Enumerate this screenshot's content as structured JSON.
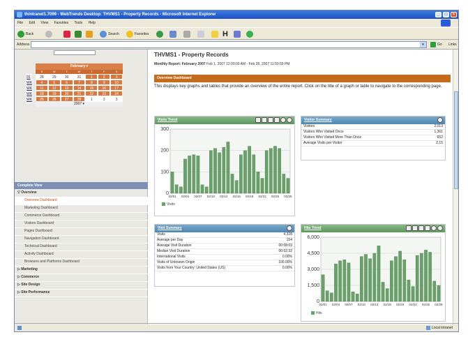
{
  "window": {
    "title": "thintranet1.7099 - WebTrends Desktop: THVMS1 - Property Records - Microsoft Internet Explorer"
  },
  "menu": [
    "File",
    "Edit",
    "View",
    "Favorites",
    "Tools",
    "Help"
  ],
  "toolbar": {
    "back": "Back",
    "search": "Search",
    "favorites": "Favorites"
  },
  "address": {
    "label": "Address",
    "go": "Go",
    "links": "Links"
  },
  "status": {
    "zone": "Local intranet"
  },
  "calendar": {
    "month": "February",
    "days": [
      "S",
      "M",
      "T",
      "W",
      "T",
      "F",
      "S"
    ],
    "weeks": [
      {
        "wk": "01",
        "cells": [
          "28",
          "29",
          "30",
          "31",
          "1",
          "2",
          "3"
        ]
      },
      {
        "wk": "WK",
        "cells": [
          "4",
          "5",
          "6",
          "7",
          "8",
          "9",
          "10"
        ]
      },
      {
        "wk": "WK",
        "cells": [
          "11",
          "12",
          "13",
          "14",
          "15",
          "16",
          "17"
        ]
      },
      {
        "wk": "WK",
        "cells": [
          "18",
          "19",
          "20",
          "21",
          "22",
          "23",
          "24"
        ]
      },
      {
        "wk": "WK",
        "cells": [
          "25",
          "26",
          "27",
          "28",
          "1",
          "2",
          "3"
        ]
      }
    ],
    "year": "2007"
  },
  "sidebar": {
    "complete_view": "Complete View",
    "overview": "Overview",
    "items": [
      "Overview Dashboard",
      "Marketing Dashboard",
      "Commerce Dashboard",
      "Visitors Dashboard",
      "Pages Dashboard",
      "Navigation Dashboard",
      "Technical Dashboard",
      "Activity Dashboard",
      "Browsers and Platforms Dashboard"
    ],
    "sections": [
      "Marketing",
      "Commerce",
      "Site Design",
      "Site Performance"
    ]
  },
  "page": {
    "title": "THVMS1 - Property Records",
    "report_label": "Monthly Report: February 2007",
    "report_range": "Feb 1, 2007 12:00:00 AM - Feb 28, 2007 11:59:59 PM",
    "overview_title": "Overview Dashboard",
    "overview_desc": "This displays key graphs and tables that provide an overview of the entire report. Click on the title of a graph or table to navigate to the corresponding page."
  },
  "visits_trend": {
    "title": "Visits Trend",
    "legend": "Visits",
    "yticks": [
      "300",
      "200",
      "100",
      "0"
    ],
    "xticks": [
      "02/01",
      "02/04",
      "02/07",
      "02/10",
      "02/13",
      "02/16",
      "02/19",
      "02/22",
      "02/25",
      "02/28"
    ],
    "chart_data": {
      "type": "area",
      "title": "Visits Trend",
      "ylim": [
        0,
        300
      ],
      "x": [
        "02/01",
        "02/02",
        "02/03",
        "02/04",
        "02/05",
        "02/06",
        "02/07",
        "02/08",
        "02/09",
        "02/10",
        "02/11",
        "02/12",
        "02/13",
        "02/14",
        "02/15",
        "02/16",
        "02/17",
        "02/18",
        "02/19",
        "02/20",
        "02/21",
        "02/22",
        "02/23",
        "02/24",
        "02/25",
        "02/26",
        "02/27",
        "02/28"
      ],
      "series": [
        {
          "name": "Visits",
          "values": [
            100,
            40,
            30,
            160,
            175,
            180,
            175,
            40,
            30,
            200,
            210,
            190,
            215,
            240,
            90,
            60,
            180,
            200,
            220,
            180,
            100,
            70,
            200,
            210,
            220,
            210,
            90,
            70
          ]
        }
      ]
    }
  },
  "visitor_summary": {
    "title": "Visitor Summary",
    "rows": [
      {
        "k": "Visitors",
        "v": "2,013"
      },
      {
        "k": "Visitors Who Visited Once",
        "v": "1,361"
      },
      {
        "k": "Visitors Who Visited More Than Once",
        "v": "652"
      },
      {
        "k": "Average Visits per Visitor",
        "v": "2.15"
      }
    ]
  },
  "visit_summary": {
    "title": "Visit Summary",
    "rows": [
      {
        "k": "Visits",
        "v": "4,328"
      },
      {
        "k": "Average per Day",
        "v": "154"
      },
      {
        "k": "Average Visit Duration",
        "v": "00:08:03"
      },
      {
        "k": "Median Visit Duration",
        "v": "00:02:32"
      },
      {
        "k": "International Visits",
        "v": "0.00%"
      },
      {
        "k": "Visits of Unknown Origin",
        "v": "100.00%"
      },
      {
        "k": "Visits from Your Country: United States (US)",
        "v": "0.00%"
      }
    ]
  },
  "hits_trend": {
    "title": "Hits Trend",
    "legend": "Hits",
    "yticks": [
      "6,000",
      "4,500",
      "3,000",
      "1,500",
      "0"
    ],
    "xticks": [
      "02/01",
      "02/04",
      "02/07",
      "02/10",
      "02/13",
      "02/16",
      "02/19",
      "02/22",
      "02/25",
      "02/28"
    ],
    "chart_data": {
      "type": "area",
      "title": "Hits Trend",
      "ylim": [
        0,
        6000
      ],
      "x": [
        "02/01",
        "02/02",
        "02/03",
        "02/04",
        "02/05",
        "02/06",
        "02/07",
        "02/08",
        "02/09",
        "02/10",
        "02/11",
        "02/12",
        "02/13",
        "02/14",
        "02/15",
        "02/16",
        "02/17",
        "02/18",
        "02/19",
        "02/20",
        "02/21",
        "02/22",
        "02/23",
        "02/24",
        "02/25",
        "02/26",
        "02/27",
        "02/28"
      ],
      "series": [
        {
          "name": "Hits",
          "values": [
            2500,
            1000,
            800,
            3500,
            3800,
            3900,
            3600,
            900,
            700,
            4200,
            4400,
            4000,
            4500,
            5200,
            1800,
            1200,
            3800,
            4200,
            4700,
            3900,
            2000,
            1400,
            4300,
            4500,
            4800,
            4600,
            1900,
            1500
          ]
        }
      ]
    }
  }
}
